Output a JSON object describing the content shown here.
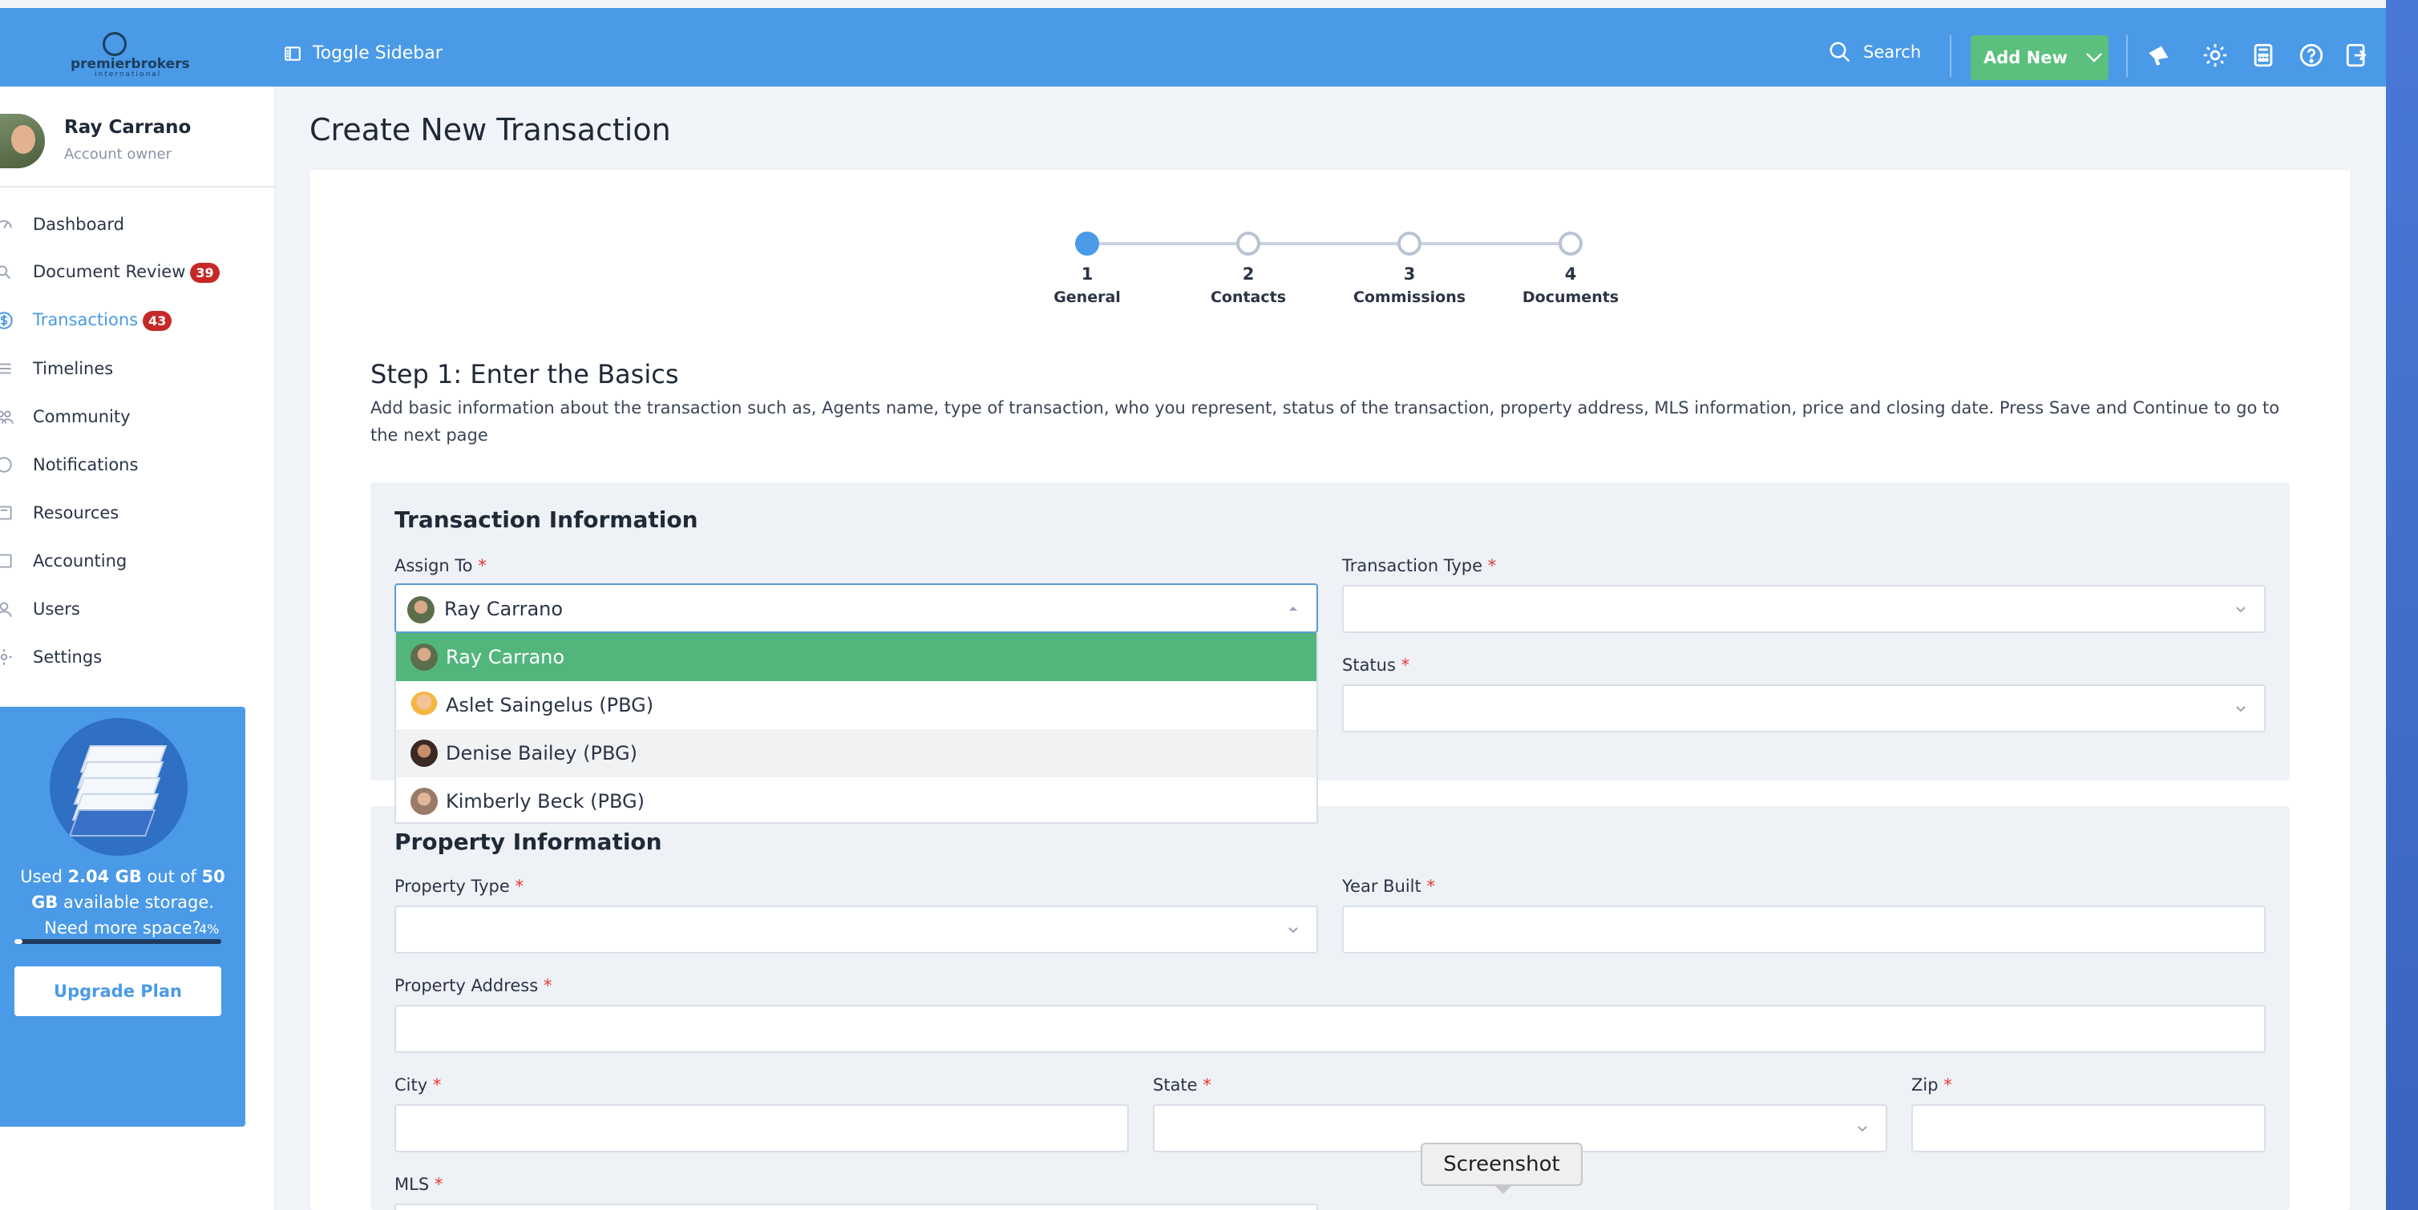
{
  "header": {
    "logo_text": "premierbrokers",
    "logo_sub": "international",
    "toggle_label": "Toggle Sidebar",
    "search_label": "Search",
    "add_new_label": "Add New"
  },
  "user": {
    "name": "Ray Carrano",
    "role": "Account owner"
  },
  "sidebar": {
    "items": [
      {
        "label": "Dashboard",
        "badge": ""
      },
      {
        "label": "Document Review",
        "badge": "39"
      },
      {
        "label": "Transactions",
        "badge": "43"
      },
      {
        "label": "Timelines",
        "badge": ""
      },
      {
        "label": "Community",
        "badge": ""
      },
      {
        "label": "Notifications",
        "badge": ""
      },
      {
        "label": "Resources",
        "badge": ""
      },
      {
        "label": "Accounting",
        "badge": ""
      },
      {
        "label": "Users",
        "badge": ""
      },
      {
        "label": "Settings",
        "badge": ""
      }
    ]
  },
  "storage": {
    "used_prefix": "Used",
    "used": "2.04 GB",
    "out_of": "out of",
    "total": "50 GB",
    "suffix": "available storage.",
    "question": "Need more space?",
    "percent_label": "4%",
    "percent": 4,
    "upgrade_label": "Upgrade Plan"
  },
  "page": {
    "title": "Create New Transaction",
    "steps": [
      {
        "num": "1",
        "label": "General",
        "done": true
      },
      {
        "num": "2",
        "label": "Contacts",
        "done": false
      },
      {
        "num": "3",
        "label": "Commissions",
        "done": false
      },
      {
        "num": "4",
        "label": "Documents",
        "done": false
      }
    ],
    "step_heading": "Step 1: Enter the Basics",
    "step_description": "Add basic information about the transaction such as, Agents name, type of transaction, who you represent, status of the transaction, property address, MLS information, price and closing date. Press Save and Continue to go to the next page"
  },
  "transaction_info": {
    "title": "Transaction Information",
    "assign_to_label": "Assign To",
    "assign_to_value": "Ray Carrano",
    "transaction_type_label": "Transaction Type",
    "status_label": "Status",
    "options": [
      {
        "label": "Ray Carrano",
        "state": "selected"
      },
      {
        "label": "Aslet Saingelus (PBG)",
        "state": ""
      },
      {
        "label": "Denise Bailey (PBG)",
        "state": "highlighted"
      },
      {
        "label": "Kimberly Beck (PBG)",
        "state": ""
      }
    ]
  },
  "property_info": {
    "title": "Property Information",
    "property_type_label": "Property Type",
    "year_built_label": "Year Built",
    "property_address_label": "Property Address",
    "city_label": "City",
    "state_label": "State",
    "zip_label": "Zip",
    "mls_label": "MLS"
  },
  "required_marker": "*",
  "tooltip": "Screenshot",
  "colors": {
    "header": "#4a9ae8",
    "add_new": "#5bbf7d",
    "selected_option": "#52b57c",
    "badge": "#c62828",
    "required": "#e53935"
  }
}
